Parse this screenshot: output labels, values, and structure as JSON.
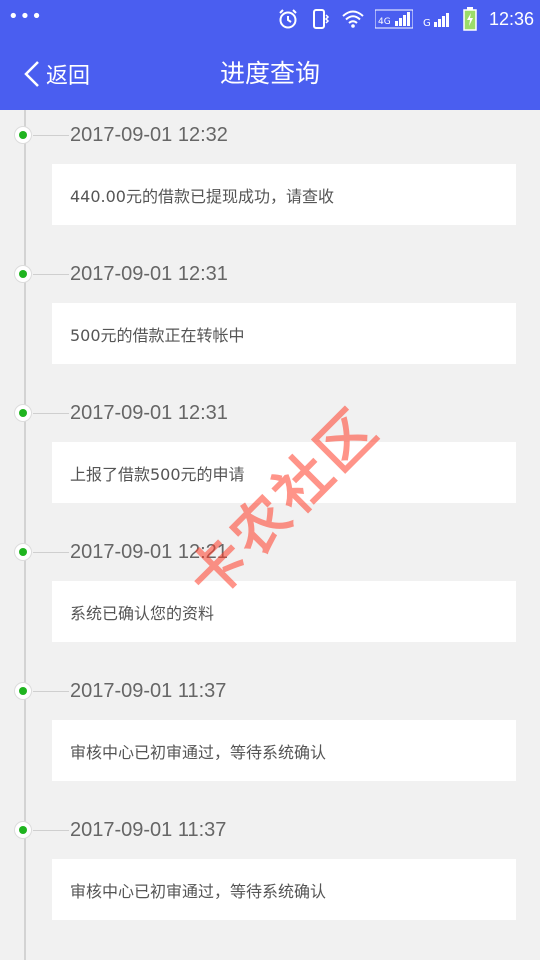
{
  "status_bar": {
    "time": "12:36",
    "network_label": "4G",
    "network_label_2": "G"
  },
  "header": {
    "back_label": "返回",
    "title": "进度查询"
  },
  "timeline": [
    {
      "time": "2017-09-01 12:32",
      "message": "440.00元的借款已提现成功，请查收"
    },
    {
      "time": "2017-09-01 12:31",
      "message": "500元的借款正在转帐中"
    },
    {
      "time": "2017-09-01 12:31",
      "message": "上报了借款500元的申请"
    },
    {
      "time": "2017-09-01 12:21",
      "message": "系统已确认您的资料"
    },
    {
      "time": "2017-09-01 11:37",
      "message": "审核中心已初审通过，等待系统确认"
    },
    {
      "time": "2017-09-01 11:37",
      "message": "审核中心已初审通过，等待系统确认"
    }
  ],
  "watermark": {
    "text": "卡农社区"
  },
  "colors": {
    "header_bg": "#4a5ef0",
    "node_green": "#1fb41f",
    "page_bg": "#f1f1f1",
    "card_bg": "#ffffff"
  }
}
